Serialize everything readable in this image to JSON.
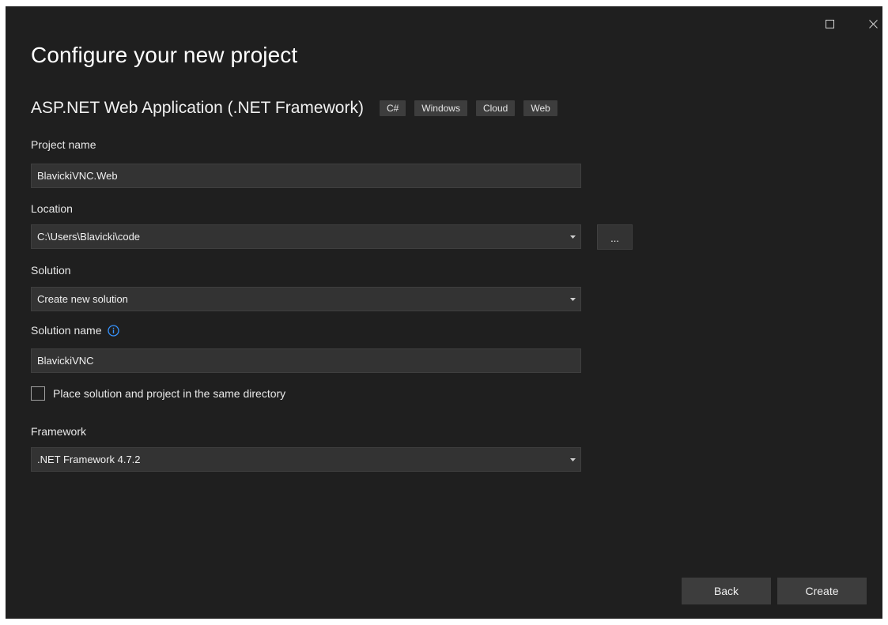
{
  "window": {
    "title": "Configure your new project",
    "buttons": [
      "maximize-icon",
      "close-icon"
    ]
  },
  "template": {
    "name": "ASP.NET Web Application (.NET Framework)",
    "tags": [
      "C#",
      "Windows",
      "Cloud",
      "Web"
    ]
  },
  "form": {
    "project_name": {
      "label": "Project name",
      "value": "BlavickiVNC.Web"
    },
    "location": {
      "label": "Location",
      "value": "C:\\Users\\Blavicki\\code",
      "browse_label": "..."
    },
    "solution": {
      "label": "Solution",
      "value": "Create new solution"
    },
    "solution_name": {
      "label": "Solution name",
      "value": "BlavickiVNC"
    },
    "same_directory": {
      "label": "Place solution and project in the same directory",
      "checked": false
    },
    "framework": {
      "label": "Framework",
      "value": ".NET Framework 4.7.2"
    }
  },
  "footer": {
    "back_label": "Back",
    "create_label": "Create"
  },
  "colors": {
    "background": "#1f1f1f",
    "field": "#333333",
    "button": "#3d3d3d",
    "info_icon": "#3794ff"
  }
}
